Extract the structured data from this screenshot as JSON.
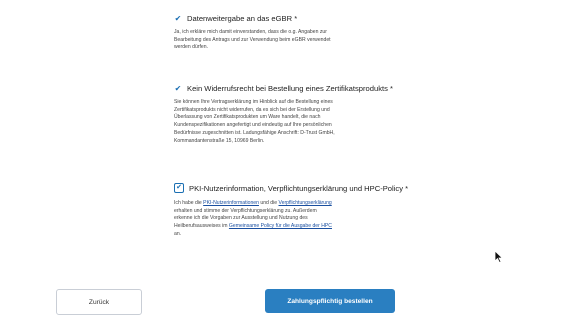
{
  "consents": [
    {
      "title": "Datenweitergabe an das eGBR *",
      "lines": [
        "Ja, ich erkläre mich damit einverstanden, dass die o.g. Angaben zur",
        "Bearbeitung des Antrags und zur Verwendung beim eGBR verwendet",
        "werden dürfen."
      ]
    },
    {
      "title": "Kein Widerrufsrecht bei Bestellung eines Zertifikatsprodukts *",
      "lines": [
        "Sie können Ihre Vertragserklärung im Hinblick auf die Bestellung eines",
        "Zertifikatsprodukts nicht widerrufen, da es sich bei der Erstellung und",
        "Überlassung von Zertifikatsprodukten um Ware handelt, die nach",
        "Kundenspezifikationen angefertigt und eindeutig auf Ihre persönlichen",
        "Bedürfnisse zugeschnitten ist. Ladungsfähige Anschrift: D-Trust GmbH,",
        "Kommandantenstraße 15, 10969 Berlin."
      ]
    },
    {
      "title": "PKI-Nutzerinformation, Verpflichtungserklärung und HPC-Policy *",
      "text": {
        "p1": "Ich habe die ",
        "link1": "PKI-Nutzerinformationen",
        "p2": " und die ",
        "link2": "Verpflichtungserklärung",
        "p3": "erhalten und stimme der Verpflichtungserklärung zu. Außerdem",
        "p4": "erkenne ich die Vorgaben zur Ausstellung und Nutzung des",
        "p5": "Heilberufsausweises im ",
        "link3": "Gemeinsame Policy für die Ausgabe der HPC",
        "p6": "an."
      }
    }
  ],
  "buttons": {
    "back_label": "Zurück",
    "order_label": "Zahlungspflichtig bestellen"
  },
  "colors": {
    "accent": "#2a7fc1",
    "link": "#1a4fa0"
  }
}
